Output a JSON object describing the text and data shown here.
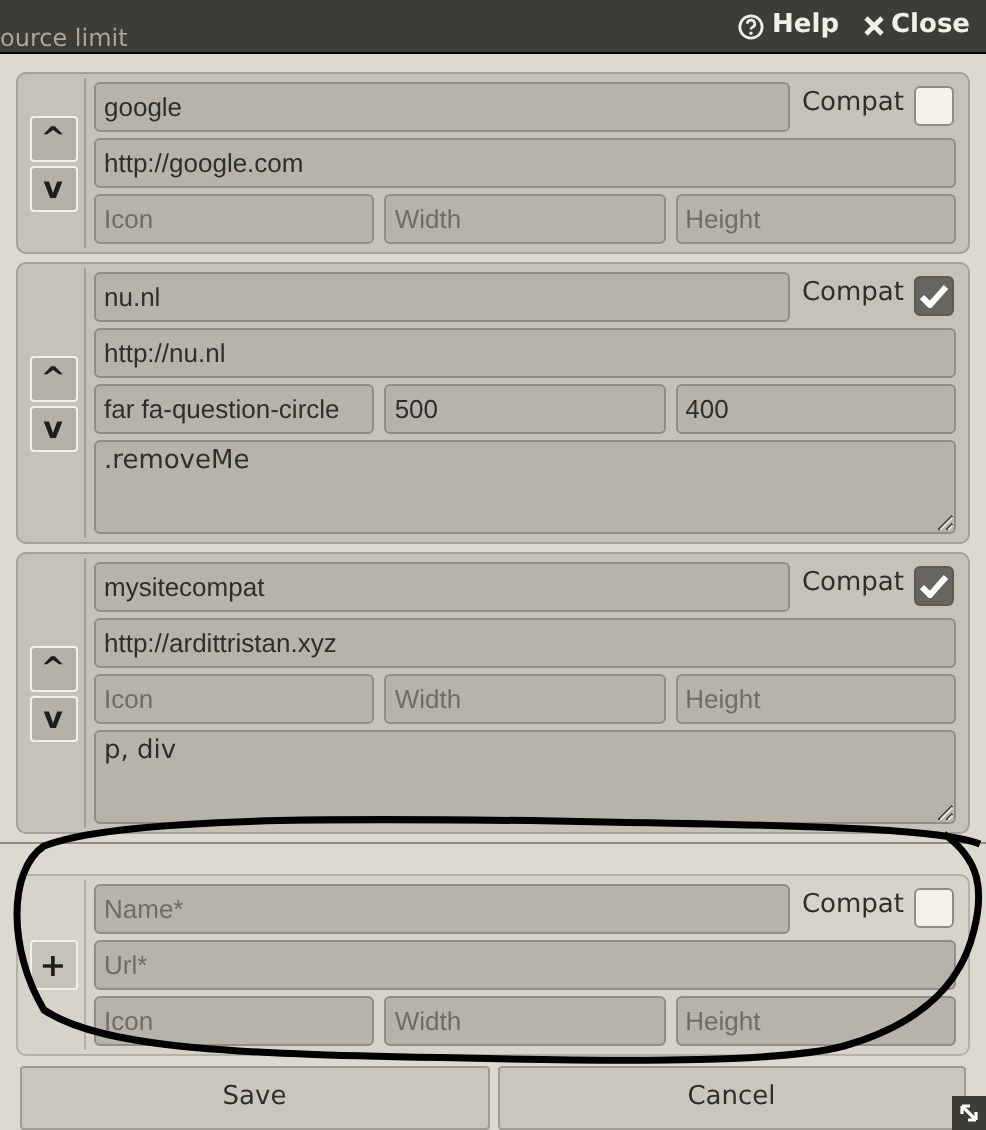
{
  "header": {
    "background_label": "ource limit",
    "help": "Help",
    "close": "Close"
  },
  "entries": [
    {
      "name": {
        "value": "google"
      },
      "compat_label": "Compat",
      "compat": false,
      "url": {
        "value": "http://google.com"
      },
      "icon": {
        "placeholder": "Icon"
      },
      "width": {
        "placeholder": "Width"
      },
      "height": {
        "placeholder": "Height"
      },
      "up": "^",
      "down": "v"
    },
    {
      "name": {
        "value": "nu.nl"
      },
      "compat_label": "Compat",
      "compat": true,
      "url": {
        "value": "http://nu.nl"
      },
      "icon": {
        "value": "far fa-question-circle"
      },
      "width": {
        "value": "500"
      },
      "height": {
        "value": "400"
      },
      "selector": {
        "value": ".removeMe"
      },
      "up": "^",
      "down": "v"
    },
    {
      "name": {
        "value": "mysitecompat"
      },
      "compat_label": "Compat",
      "compat": true,
      "url": {
        "value": "http://ardittristan.xyz"
      },
      "icon": {
        "placeholder": "Icon"
      },
      "width": {
        "placeholder": "Width"
      },
      "height": {
        "placeholder": "Height"
      },
      "selector": {
        "value": "p, div"
      },
      "up": "^",
      "down": "v"
    }
  ],
  "new_entry": {
    "add": "+",
    "name": {
      "placeholder": "Name*"
    },
    "compat_label": "Compat",
    "compat": false,
    "url": {
      "placeholder": "Url*"
    },
    "icon": {
      "placeholder": "Icon"
    },
    "width": {
      "placeholder": "Width"
    },
    "height": {
      "placeholder": "Height"
    }
  },
  "buttons": [
    "Save",
    "Cancel"
  ]
}
